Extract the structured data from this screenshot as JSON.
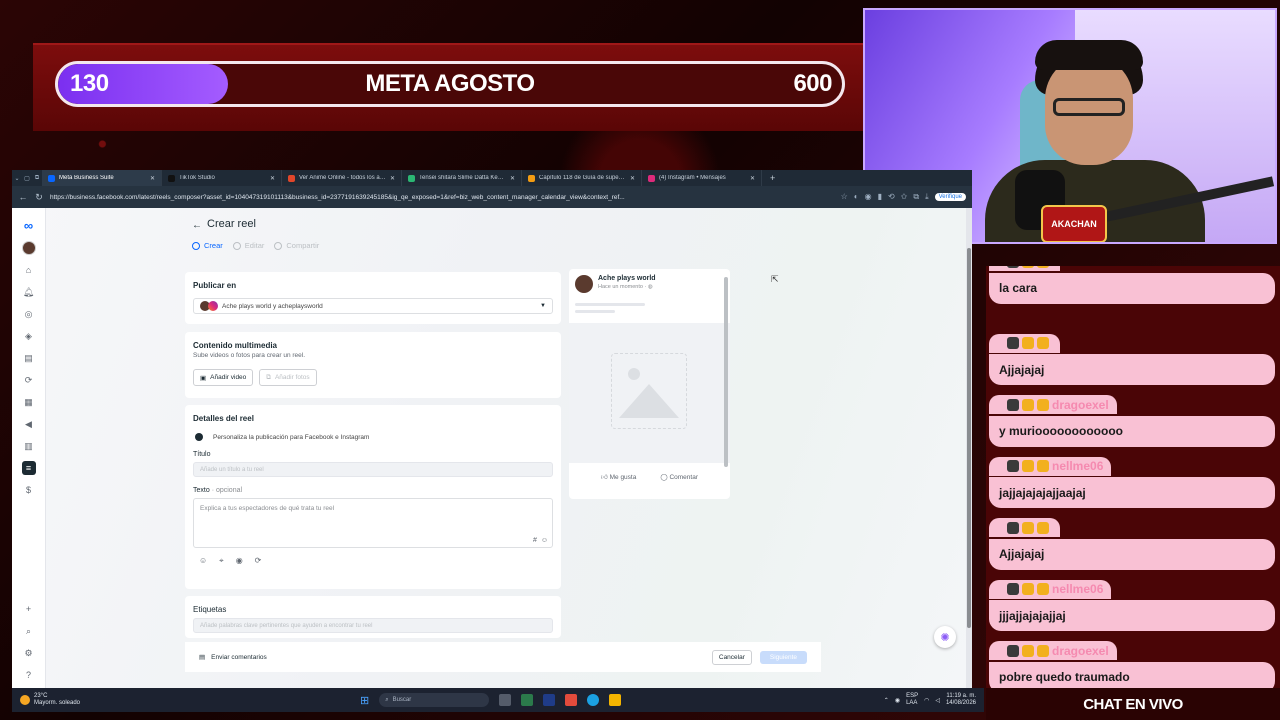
{
  "goal": {
    "current": "130",
    "title": "META AGOSTO",
    "target": "600",
    "progress_fraction": 0.217,
    "bar_color": "#7b2ff0"
  },
  "webcam": {
    "logo_text": "AKACHAN"
  },
  "browser": {
    "tabs": [
      {
        "label": "Meta Business Suite",
        "favicon_color": "#0866ff",
        "active": true
      },
      {
        "label": "TikTok Studio",
        "favicon_color": "#111111",
        "active": false
      },
      {
        "label": "Ver Anime Online - todos los anim",
        "favicon_color": "#e0462a",
        "active": false
      },
      {
        "label": "Tensei shitara Slime Datta Ken 4th",
        "favicon_color": "#2bb673",
        "active": false
      },
      {
        "label": "Capítulo 118 de Guía de supervivi",
        "favicon_color": "#f39c12",
        "active": false
      },
      {
        "label": "(4) Instagram • Mensajes",
        "favicon_color": "#dd2a7b",
        "active": false
      }
    ],
    "url": "https://business.facebook.com/latest/reels_composer?asset_id=104047319101113&business_id=2377191639245185&ig_qe_exposed=1&ref=biz_web_content_manager_calendar_view&context_ref...",
    "verify_label": "Verifique"
  },
  "page": {
    "title": "Crear reel",
    "steps": [
      "Crear",
      "Editar",
      "Compartir"
    ],
    "publish": {
      "title": "Publicar en",
      "account": "Ache plays world y acheplaysworld"
    },
    "media": {
      "title": "Contenido multimedia",
      "subtitle": "Sube videos o fotos para crear un reel.",
      "add_video": "Añadir video",
      "add_photos": "Añadir fotos"
    },
    "details": {
      "title": "Detalles del reel",
      "personalize": "Personaliza la publicación para Facebook e Instagram",
      "title_label": "Título",
      "title_placeholder": "Añade un título a tu reel",
      "text_label": "Texto",
      "text_optional": "· opcional",
      "text_placeholder": "Explica a tus espectadores de qué trata tu reel"
    },
    "tags": {
      "title": "Etiquetas",
      "placeholder": "Añade palabras clave pertinentes que ayuden a encontrar tu reel"
    },
    "preview": {
      "name": "Ache plays world",
      "time": "Hace un momento",
      "like": "Me gusta",
      "comment": "Comentar"
    },
    "footer": {
      "feedback": "Enviar comentarios",
      "cancel": "Cancelar",
      "next": "Siguiente"
    }
  },
  "taskbar": {
    "temp": "23°C",
    "weather": "Mayorm. soleado",
    "search": "Buscar",
    "lang": "ESP",
    "lang_region": "LAA",
    "time": "11:19 a. m.",
    "date": "14/08/2026"
  },
  "chat": {
    "footer": "CHAT EN VIVO",
    "messages": [
      {
        "user": "",
        "text": "la cara"
      },
      {
        "user": "",
        "text": "Ajjajajaj"
      },
      {
        "user": "dragoexel",
        "text": "y murioooooooooooo"
      },
      {
        "user": "nellme06",
        "text": "jajjajajajajjaajaj"
      },
      {
        "user": "",
        "text": "Ajjajajaj"
      },
      {
        "user": "nellme06",
        "text": "jjjajjajajajjaj"
      },
      {
        "user": "dragoexel",
        "text": "pobre quedo traumado"
      }
    ]
  }
}
